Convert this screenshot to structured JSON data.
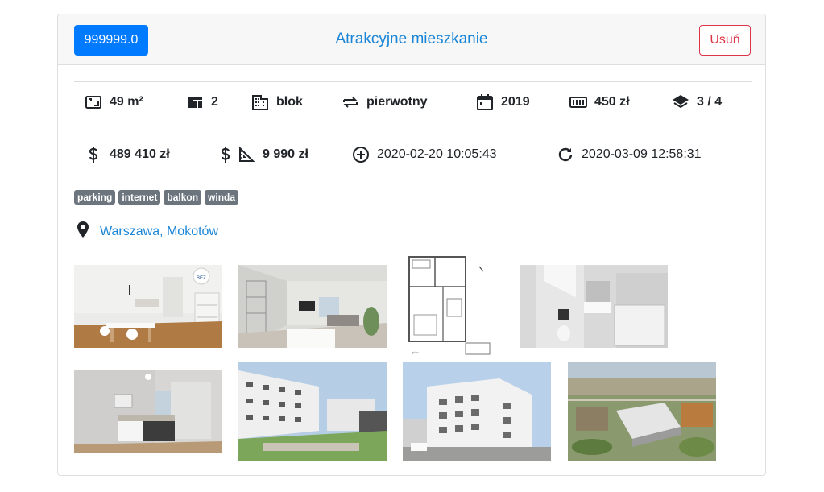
{
  "header": {
    "id_value": "999999.0",
    "title": "Atrakcyjne mieszkanie",
    "delete_label": "Usuń"
  },
  "stats_row1": {
    "area": "49 m²",
    "rooms": "2",
    "building": "blok",
    "market": "pierwotny",
    "year": "2019",
    "rent": "450 zł",
    "floor": "3 / 4"
  },
  "stats_row2": {
    "price": "489 410 zł",
    "price_per_m2": "9 990 zł",
    "created": "2020-02-20 10:05:43",
    "updated": "2020-03-09 12:58:31"
  },
  "tags": [
    "parking",
    "internet",
    "balkon",
    "winda"
  ],
  "location": {
    "text": "Warszawa, Mokotów"
  },
  "photos": [
    {
      "name": "photo-kitchen-dining"
    },
    {
      "name": "photo-living-room"
    },
    {
      "name": "photo-floor-plan"
    },
    {
      "name": "photo-bathroom"
    },
    {
      "name": "photo-bedroom"
    },
    {
      "name": "photo-building-courtyard"
    },
    {
      "name": "photo-building-exterior"
    },
    {
      "name": "photo-aerial-view"
    }
  ],
  "icons": {
    "accent": "#007bff",
    "link": "#1a85d6",
    "danger": "#dc3545",
    "tag": "#6c757d"
  }
}
